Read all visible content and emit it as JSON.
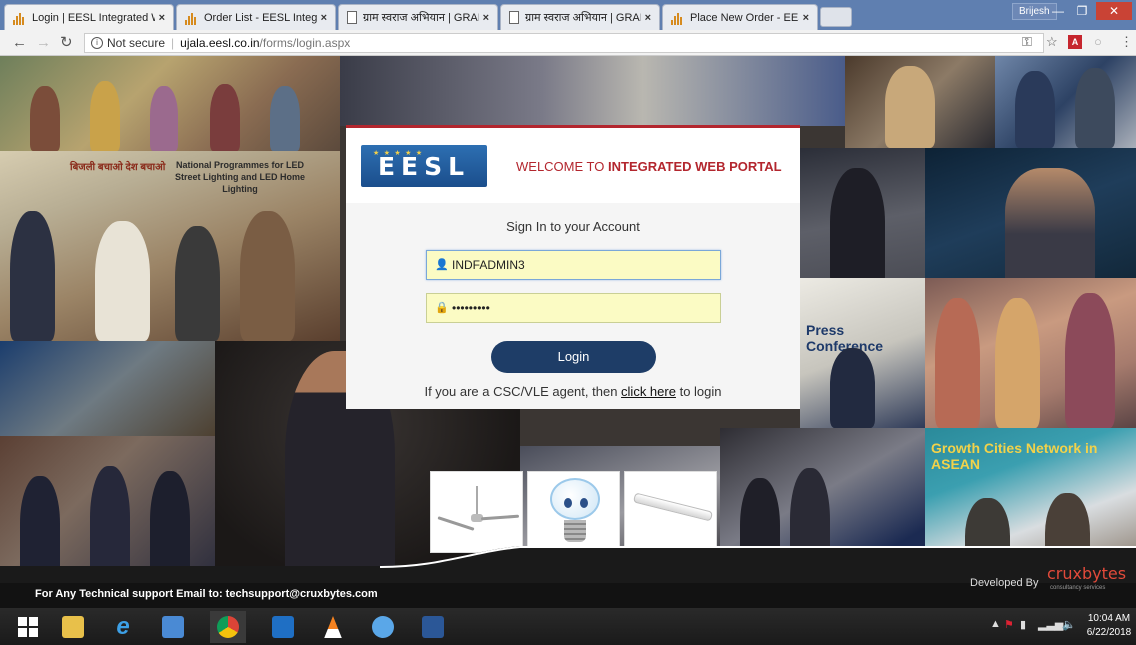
{
  "browser": {
    "tabs": [
      {
        "title": "Login | EESL Integrated W",
        "active": true,
        "icon": "eesl-favicon"
      },
      {
        "title": "Order List - EESL Integrat",
        "active": false,
        "icon": "eesl-favicon"
      },
      {
        "title": "ग्राम स्वराज अभियान | GRAI",
        "active": false,
        "icon": "document-icon"
      },
      {
        "title": "ग्राम स्वराज अभियान | GRAI",
        "active": false,
        "icon": "document-icon"
      },
      {
        "title": "Place New Order - EESL I",
        "active": false,
        "icon": "eesl-favicon"
      }
    ],
    "tab_close_glyph": "×",
    "user": "Brijesh",
    "address": {
      "security": "Not secure",
      "host": "ujala.eesl.co.in",
      "path": "/forms/login.aspx"
    }
  },
  "page": {
    "logo_text": "EESL",
    "welcome_prefix": "WELCOME TO",
    "welcome_emphasis": "INTEGRATED WEB PORTAL",
    "signin_title": "Sign In to your Account",
    "username_value": "INDFADMIN3",
    "password_value": "•••••••••",
    "login_label": "Login",
    "csc_prefix": "If you are a CSC/VLE agent, then",
    "csc_link": "click here",
    "csc_suffix": "to login",
    "poster": {
      "hindi": "बिजली बचाओ देश बचाओ",
      "title": "National Programmes for LED Street Lighting and LED Home Lighting"
    },
    "conference_text": "Press Conference",
    "asean_text": "Growth Cities Network in ASEAN"
  },
  "footer": {
    "support": "For Any Technical support Email to: techsupport@cruxbytes.com",
    "developed_by": "Developed By",
    "brand": "cruxbytes",
    "brand_tag": "consultancy services"
  },
  "taskbar": {
    "time": "10:04 AM",
    "date": "6/22/2018"
  },
  "colors": {
    "accent_red": "#b3262e",
    "login_button": "#1e3d67",
    "field_fill": "#fbfbc4"
  }
}
